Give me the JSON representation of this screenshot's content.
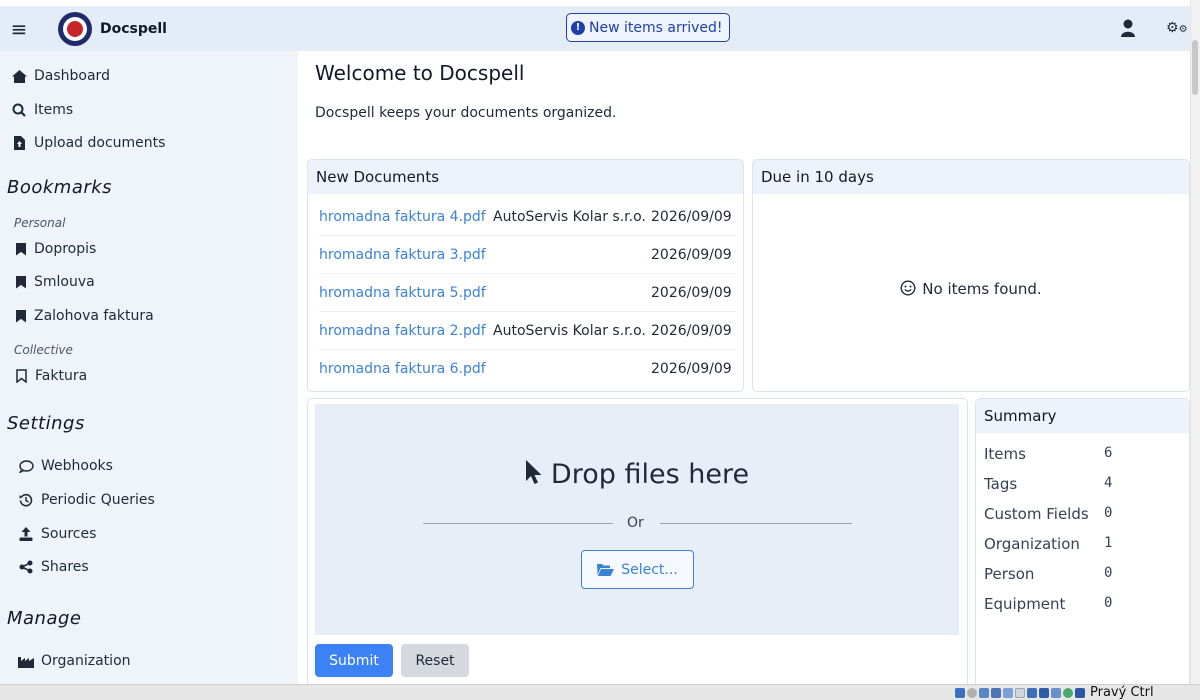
{
  "header": {
    "app_name": "Docspell",
    "notice": "New items arrived!"
  },
  "sidebar": {
    "nav": [
      {
        "label": "Dashboard",
        "icon": "home-icon"
      },
      {
        "label": "Items",
        "icon": "search-icon"
      },
      {
        "label": "Upload documents",
        "icon": "file-upload-icon"
      }
    ],
    "bookmarks_title": "Bookmarks",
    "personal_label": "Personal",
    "personal": [
      "Dopropis",
      "Smlouva",
      "Zalohova faktura"
    ],
    "collective_label": "Collective",
    "collective": [
      "Faktura"
    ],
    "settings_title": "Settings",
    "settings": [
      {
        "label": "Webhooks",
        "icon": "comment-icon"
      },
      {
        "label": "Periodic Queries",
        "icon": "history-icon"
      },
      {
        "label": "Sources",
        "icon": "upload-icon"
      },
      {
        "label": "Shares",
        "icon": "share-icon"
      }
    ],
    "manage_title": "Manage",
    "manage": [
      {
        "label": "Organization",
        "icon": "industry-icon"
      }
    ]
  },
  "main": {
    "title": "Welcome to Docspell",
    "subtitle": "Docspell keeps your documents organized."
  },
  "new_documents": {
    "title": "New Documents",
    "rows": [
      {
        "name": "hromadna faktura 4.pdf",
        "org": "AutoServis Kolar s.r.o.",
        "date": "2026/09/09"
      },
      {
        "name": "hromadna faktura 3.pdf",
        "org": "",
        "date": "2026/09/09"
      },
      {
        "name": "hromadna faktura 5.pdf",
        "org": "",
        "date": "2026/09/09"
      },
      {
        "name": "hromadna faktura 2.pdf",
        "org": "AutoServis Kolar s.r.o.",
        "date": "2026/09/09"
      },
      {
        "name": "hromadna faktura 6.pdf",
        "org": "",
        "date": "2026/09/09"
      }
    ]
  },
  "due": {
    "title": "Due in 10 days",
    "empty": "No items found."
  },
  "upload": {
    "drop_text": "Drop files here",
    "or": "Or",
    "select": "Select...",
    "submit": "Submit",
    "reset": "Reset"
  },
  "summary": {
    "title": "Summary",
    "rows": [
      {
        "label": "Items",
        "value": "6"
      },
      {
        "label": "Tags",
        "value": "4"
      },
      {
        "label": "Custom Fields",
        "value": "0"
      },
      {
        "label": "Organization",
        "value": "1"
      },
      {
        "label": "Person",
        "value": "0"
      },
      {
        "label": "Equipment",
        "value": "0"
      }
    ]
  },
  "taskbar": {
    "keyboard_label": "Pravý Ctrl"
  }
}
